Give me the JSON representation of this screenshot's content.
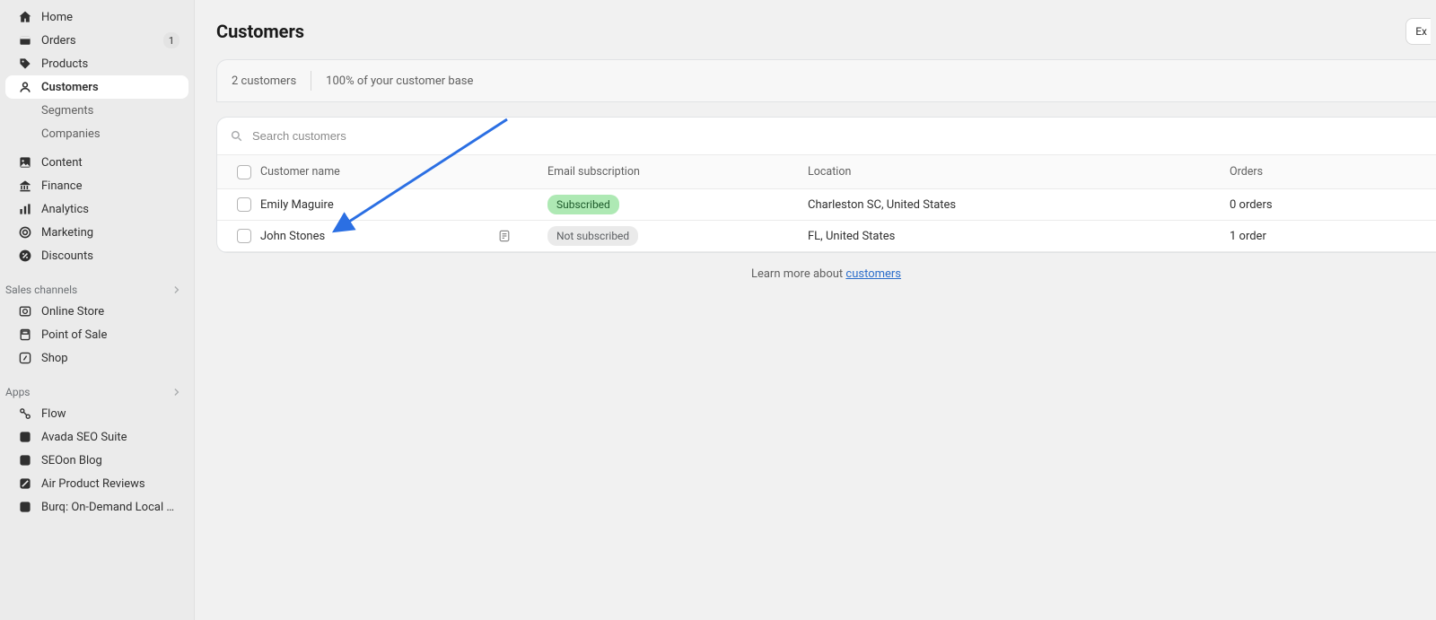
{
  "sidebar": {
    "primary": [
      {
        "id": "home",
        "label": "Home",
        "icon": "home"
      },
      {
        "id": "orders",
        "label": "Orders",
        "icon": "orders",
        "badge": "1"
      },
      {
        "id": "products",
        "label": "Products",
        "icon": "products"
      },
      {
        "id": "customers",
        "label": "Customers",
        "icon": "customers",
        "active": true,
        "sub": [
          {
            "id": "segments",
            "label": "Segments"
          },
          {
            "id": "companies",
            "label": "Companies"
          }
        ]
      },
      {
        "id": "content",
        "label": "Content",
        "icon": "content"
      },
      {
        "id": "finance",
        "label": "Finance",
        "icon": "finance"
      },
      {
        "id": "analytics",
        "label": "Analytics",
        "icon": "analytics"
      },
      {
        "id": "marketing",
        "label": "Marketing",
        "icon": "marketing"
      },
      {
        "id": "discounts",
        "label": "Discounts",
        "icon": "discounts"
      }
    ],
    "channels_heading": "Sales channels",
    "channels": [
      {
        "id": "online-store",
        "label": "Online Store",
        "icon": "onlinestore"
      },
      {
        "id": "pos",
        "label": "Point of Sale",
        "icon": "pos"
      },
      {
        "id": "shop",
        "label": "Shop",
        "icon": "shop"
      }
    ],
    "apps_heading": "Apps",
    "apps": [
      {
        "id": "flow",
        "label": "Flow",
        "icon": "flow"
      },
      {
        "id": "avada",
        "label": "Avada SEO Suite",
        "icon": "app"
      },
      {
        "id": "seoon",
        "label": "SEOon Blog",
        "icon": "app-dark"
      },
      {
        "id": "air",
        "label": "Air Product Reviews",
        "icon": "air"
      },
      {
        "id": "burq",
        "label": "Burq: On-Demand Local D...",
        "icon": "app"
      }
    ]
  },
  "page": {
    "title": "Customers",
    "export_fragment": "Ex"
  },
  "summary": {
    "count_text": "2 customers",
    "percent_text": "100% of your customer base"
  },
  "table": {
    "search_placeholder": "Search customers",
    "columns": {
      "name": "Customer name",
      "email": "Email subscription",
      "location": "Location",
      "orders": "Orders"
    },
    "rows": [
      {
        "name": "Emily Maguire",
        "subscription": "Subscribed",
        "sub_style": "subscribed",
        "location": "Charleston SC, United States",
        "orders": "0 orders",
        "note": false
      },
      {
        "name": "John Stones",
        "subscription": "Not subscribed",
        "sub_style": "notsub",
        "location": "FL, United States",
        "orders": "1 order",
        "note": true
      }
    ],
    "footer_prefix": "Learn more about ",
    "footer_link": "customers"
  }
}
